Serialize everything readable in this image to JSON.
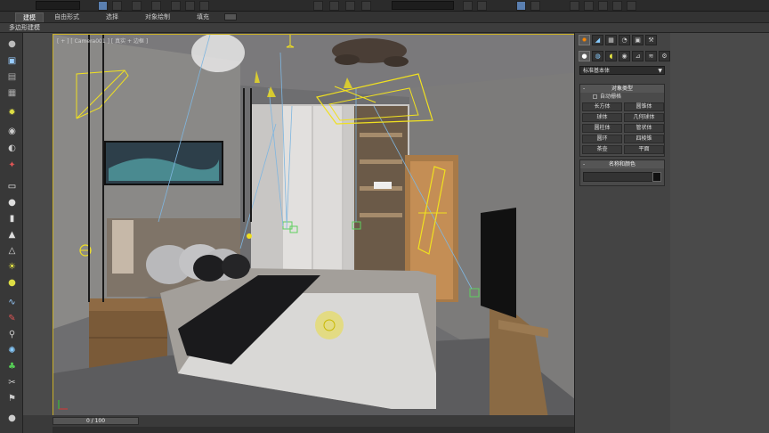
{
  "ribbon": {
    "tabs": [
      {
        "label": "建模",
        "active": true
      },
      {
        "label": "自由形式",
        "active": false
      },
      {
        "label": "选择",
        "active": false
      },
      {
        "label": "对象绘制",
        "active": false
      },
      {
        "label": "填充",
        "active": false
      }
    ],
    "sub_label": "多边形建模"
  },
  "viewport": {
    "label": "[ + ] [ Camera001 ] [ 真实 + 边框 ]"
  },
  "timeline": {
    "slider_text": "0 / 100"
  },
  "command_panel": {
    "dropdown_value": "标准基本体",
    "object_type": {
      "title": "对象类型",
      "autogrid_label": "自动栅格",
      "buttons": [
        "长方体",
        "圆锥体",
        "球体",
        "几何球体",
        "圆柱体",
        "管状体",
        "圆环",
        "四棱锥",
        "茶壶",
        "平面"
      ]
    },
    "name_color": {
      "title": "名称和颜色"
    }
  },
  "colors": {
    "viewport_border": "#c9b028",
    "light_gizmo": "#f0e020",
    "camera_line": "#7fb6e0",
    "selection_green": "#5ed05e"
  }
}
